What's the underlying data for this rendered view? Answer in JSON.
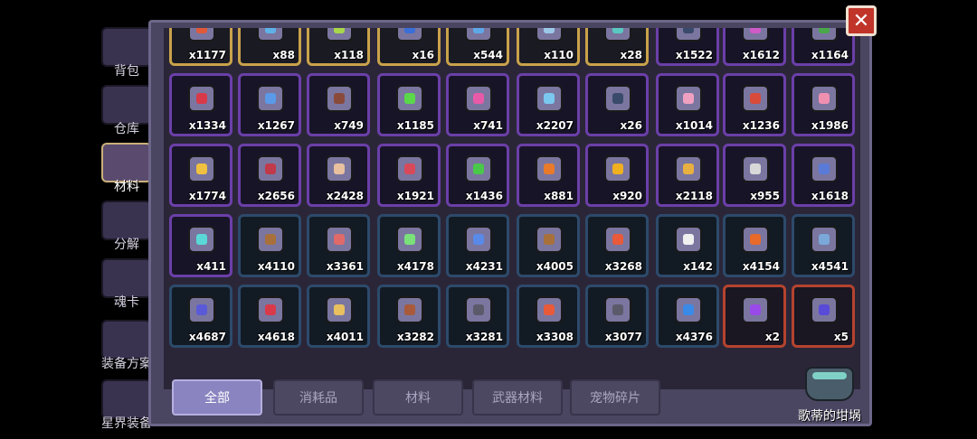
{
  "sidebar": {
    "items": [
      {
        "label": "背包",
        "icon": "backpack-icon"
      },
      {
        "label": "仓库",
        "icon": "warehouse-icon"
      },
      {
        "label": "材料",
        "icon": "materials-icon",
        "active": true
      },
      {
        "label": "分解",
        "icon": "decompose-icon"
      },
      {
        "label": "魂卡",
        "icon": "soul-card-icon"
      },
      {
        "label": "装备方案",
        "icon": "equipment-plan-icon"
      },
      {
        "label": "星界装备",
        "icon": "astral-equipment-icon"
      }
    ]
  },
  "inventory": {
    "rows": [
      [
        {
          "count": "x1177",
          "frame": "gold",
          "icon_color": "#e05a3a"
        },
        {
          "count": "x88",
          "frame": "gold",
          "icon_color": "#5fb2e8"
        },
        {
          "count": "x118",
          "frame": "gold",
          "icon_color": "#a8d84a"
        },
        {
          "count": "x16",
          "frame": "gold",
          "icon_color": "#3a6fd8"
        },
        {
          "count": "x544",
          "frame": "gold",
          "icon_color": "#5fa8e8"
        },
        {
          "count": "x110",
          "frame": "gold",
          "icon_color": "#9cc8e8"
        },
        {
          "count": "x28",
          "frame": "gold",
          "icon_color": "#5ac8c0"
        },
        {
          "count": "x1522",
          "frame": "purple",
          "icon_color": "#3a4a6a"
        },
        {
          "count": "x1612",
          "frame": "purple",
          "icon_color": "#d05ac8"
        },
        {
          "count": "x1164",
          "frame": "purple",
          "icon_color": "#4aa84a"
        }
      ],
      [
        {
          "count": "x1334",
          "frame": "purple",
          "icon_color": "#d83a4a"
        },
        {
          "count": "x1267",
          "frame": "purple",
          "icon_color": "#5a9ae8"
        },
        {
          "count": "x749",
          "frame": "purple",
          "icon_color": "#8a4a3a"
        },
        {
          "count": "x1185",
          "frame": "purple",
          "icon_color": "#5ad84a"
        },
        {
          "count": "x741",
          "frame": "purple",
          "icon_color": "#e85aa8"
        },
        {
          "count": "x2207",
          "frame": "purple",
          "icon_color": "#7ac8f0"
        },
        {
          "count": "x26",
          "frame": "purple",
          "icon_color": "#3a4a6a"
        },
        {
          "count": "x1014",
          "frame": "purple",
          "icon_color": "#f0a0c0"
        },
        {
          "count": "x1236",
          "frame": "purple",
          "icon_color": "#d84a3a"
        },
        {
          "count": "x1986",
          "frame": "purple",
          "icon_color": "#f090b0"
        }
      ],
      [
        {
          "count": "x1774",
          "frame": "purple",
          "icon_color": "#f0c040"
        },
        {
          "count": "x2656",
          "frame": "purple",
          "icon_color": "#c03a4a"
        },
        {
          "count": "x2428",
          "frame": "purple",
          "icon_color": "#e8c0a0"
        },
        {
          "count": "x1921",
          "frame": "purple",
          "icon_color": "#d84a5a"
        },
        {
          "count": "x1436",
          "frame": "purple",
          "icon_color": "#4ac84a"
        },
        {
          "count": "x881",
          "frame": "purple",
          "icon_color": "#e87a2a"
        },
        {
          "count": "x920",
          "frame": "purple",
          "icon_color": "#f0b020"
        },
        {
          "count": "x2118",
          "frame": "purple",
          "icon_color": "#e8b040"
        },
        {
          "count": "x955",
          "frame": "purple",
          "icon_color": "#d8d8d8"
        },
        {
          "count": "x1618",
          "frame": "purple",
          "icon_color": "#5a7ad8"
        }
      ],
      [
        {
          "count": "x411",
          "frame": "purple",
          "icon_color": "#5ad8d8"
        },
        {
          "count": "x4110",
          "frame": "blue",
          "icon_color": "#a8703a"
        },
        {
          "count": "x3361",
          "frame": "blue",
          "icon_color": "#e06a6a"
        },
        {
          "count": "x4178",
          "frame": "blue",
          "icon_color": "#7ae07a"
        },
        {
          "count": "x4231",
          "frame": "blue",
          "icon_color": "#5a8ae8"
        },
        {
          "count": "x4005",
          "frame": "blue",
          "icon_color": "#a8703a"
        },
        {
          "count": "x3268",
          "frame": "blue",
          "icon_color": "#e85a3a"
        },
        {
          "count": "x142",
          "frame": "blue",
          "icon_color": "#f0f0f0"
        },
        {
          "count": "x4154",
          "frame": "blue",
          "icon_color": "#e86a2a"
        },
        {
          "count": "x4541",
          "frame": "blue",
          "icon_color": "#7aa8d8"
        }
      ],
      [
        {
          "count": "x4687",
          "frame": "blue",
          "icon_color": "#5a5ad8"
        },
        {
          "count": "x4618",
          "frame": "blue",
          "icon_color": "#d83a4a"
        },
        {
          "count": "x4011",
          "frame": "blue",
          "icon_color": "#e8c060"
        },
        {
          "count": "x3282",
          "frame": "blue",
          "icon_color": "#a85a3a"
        },
        {
          "count": "x3281",
          "frame": "blue",
          "icon_color": "#5a5a6a"
        },
        {
          "count": "x3308",
          "frame": "blue",
          "icon_color": "#e85a3a"
        },
        {
          "count": "x3077",
          "frame": "blue",
          "icon_color": "#5a5a6a"
        },
        {
          "count": "x4376",
          "frame": "blue",
          "icon_color": "#3a8ae8"
        },
        {
          "count": "x2",
          "frame": "red",
          "icon_color": "#9a4ae8"
        },
        {
          "count": "x5",
          "frame": "red",
          "icon_color": "#5a4ad8"
        }
      ]
    ]
  },
  "tabs": [
    {
      "label": "全部",
      "active": true
    },
    {
      "label": "消耗品"
    },
    {
      "label": "材料"
    },
    {
      "label": "武器材料"
    },
    {
      "label": "宠物碎片"
    }
  ],
  "cauldron": {
    "label": "歌蒂的坩埚"
  },
  "close_label": "✕"
}
